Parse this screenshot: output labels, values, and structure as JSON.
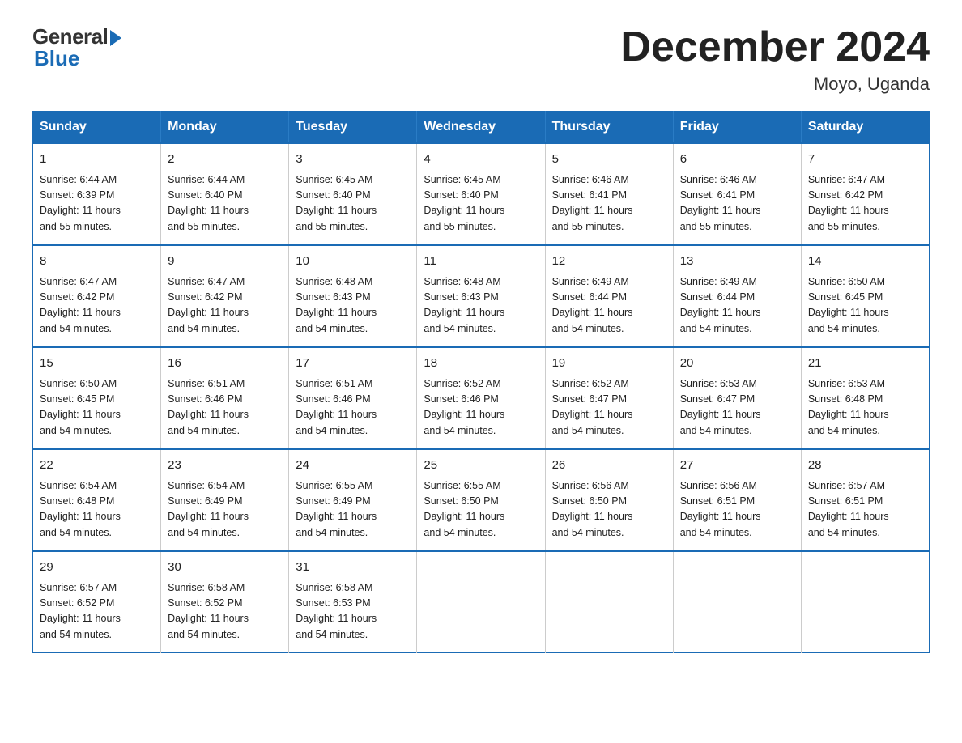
{
  "logo": {
    "general": "General",
    "blue": "Blue"
  },
  "header": {
    "title": "December 2024",
    "location": "Moyo, Uganda"
  },
  "days_of_week": [
    "Sunday",
    "Monday",
    "Tuesday",
    "Wednesday",
    "Thursday",
    "Friday",
    "Saturday"
  ],
  "weeks": [
    [
      {
        "day": "1",
        "sunrise": "6:44 AM",
        "sunset": "6:39 PM",
        "daylight": "11 hours and 55 minutes."
      },
      {
        "day": "2",
        "sunrise": "6:44 AM",
        "sunset": "6:40 PM",
        "daylight": "11 hours and 55 minutes."
      },
      {
        "day": "3",
        "sunrise": "6:45 AM",
        "sunset": "6:40 PM",
        "daylight": "11 hours and 55 minutes."
      },
      {
        "day": "4",
        "sunrise": "6:45 AM",
        "sunset": "6:40 PM",
        "daylight": "11 hours and 55 minutes."
      },
      {
        "day": "5",
        "sunrise": "6:46 AM",
        "sunset": "6:41 PM",
        "daylight": "11 hours and 55 minutes."
      },
      {
        "day": "6",
        "sunrise": "6:46 AM",
        "sunset": "6:41 PM",
        "daylight": "11 hours and 55 minutes."
      },
      {
        "day": "7",
        "sunrise": "6:47 AM",
        "sunset": "6:42 PM",
        "daylight": "11 hours and 55 minutes."
      }
    ],
    [
      {
        "day": "8",
        "sunrise": "6:47 AM",
        "sunset": "6:42 PM",
        "daylight": "11 hours and 54 minutes."
      },
      {
        "day": "9",
        "sunrise": "6:47 AM",
        "sunset": "6:42 PM",
        "daylight": "11 hours and 54 minutes."
      },
      {
        "day": "10",
        "sunrise": "6:48 AM",
        "sunset": "6:43 PM",
        "daylight": "11 hours and 54 minutes."
      },
      {
        "day": "11",
        "sunrise": "6:48 AM",
        "sunset": "6:43 PM",
        "daylight": "11 hours and 54 minutes."
      },
      {
        "day": "12",
        "sunrise": "6:49 AM",
        "sunset": "6:44 PM",
        "daylight": "11 hours and 54 minutes."
      },
      {
        "day": "13",
        "sunrise": "6:49 AM",
        "sunset": "6:44 PM",
        "daylight": "11 hours and 54 minutes."
      },
      {
        "day": "14",
        "sunrise": "6:50 AM",
        "sunset": "6:45 PM",
        "daylight": "11 hours and 54 minutes."
      }
    ],
    [
      {
        "day": "15",
        "sunrise": "6:50 AM",
        "sunset": "6:45 PM",
        "daylight": "11 hours and 54 minutes."
      },
      {
        "day": "16",
        "sunrise": "6:51 AM",
        "sunset": "6:46 PM",
        "daylight": "11 hours and 54 minutes."
      },
      {
        "day": "17",
        "sunrise": "6:51 AM",
        "sunset": "6:46 PM",
        "daylight": "11 hours and 54 minutes."
      },
      {
        "day": "18",
        "sunrise": "6:52 AM",
        "sunset": "6:46 PM",
        "daylight": "11 hours and 54 minutes."
      },
      {
        "day": "19",
        "sunrise": "6:52 AM",
        "sunset": "6:47 PM",
        "daylight": "11 hours and 54 minutes."
      },
      {
        "day": "20",
        "sunrise": "6:53 AM",
        "sunset": "6:47 PM",
        "daylight": "11 hours and 54 minutes."
      },
      {
        "day": "21",
        "sunrise": "6:53 AM",
        "sunset": "6:48 PM",
        "daylight": "11 hours and 54 minutes."
      }
    ],
    [
      {
        "day": "22",
        "sunrise": "6:54 AM",
        "sunset": "6:48 PM",
        "daylight": "11 hours and 54 minutes."
      },
      {
        "day": "23",
        "sunrise": "6:54 AM",
        "sunset": "6:49 PM",
        "daylight": "11 hours and 54 minutes."
      },
      {
        "day": "24",
        "sunrise": "6:55 AM",
        "sunset": "6:49 PM",
        "daylight": "11 hours and 54 minutes."
      },
      {
        "day": "25",
        "sunrise": "6:55 AM",
        "sunset": "6:50 PM",
        "daylight": "11 hours and 54 minutes."
      },
      {
        "day": "26",
        "sunrise": "6:56 AM",
        "sunset": "6:50 PM",
        "daylight": "11 hours and 54 minutes."
      },
      {
        "day": "27",
        "sunrise": "6:56 AM",
        "sunset": "6:51 PM",
        "daylight": "11 hours and 54 minutes."
      },
      {
        "day": "28",
        "sunrise": "6:57 AM",
        "sunset": "6:51 PM",
        "daylight": "11 hours and 54 minutes."
      }
    ],
    [
      {
        "day": "29",
        "sunrise": "6:57 AM",
        "sunset": "6:52 PM",
        "daylight": "11 hours and 54 minutes."
      },
      {
        "day": "30",
        "sunrise": "6:58 AM",
        "sunset": "6:52 PM",
        "daylight": "11 hours and 54 minutes."
      },
      {
        "day": "31",
        "sunrise": "6:58 AM",
        "sunset": "6:53 PM",
        "daylight": "11 hours and 54 minutes."
      },
      null,
      null,
      null,
      null
    ]
  ],
  "labels": {
    "sunrise": "Sunrise:",
    "sunset": "Sunset:",
    "daylight": "Daylight:"
  }
}
